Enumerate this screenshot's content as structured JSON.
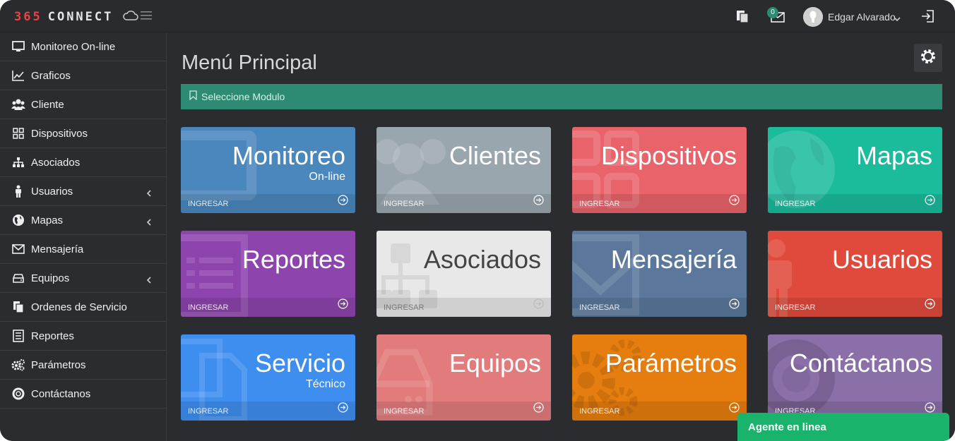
{
  "header": {
    "logo_number": "365",
    "logo_word": "CONNECT",
    "user_name": "Edgar Alvarado",
    "message_count": "0"
  },
  "sidebar": {
    "items": [
      {
        "label": "Monitoreo On-line",
        "icon": "monitor-icon"
      },
      {
        "label": "Graficos",
        "icon": "chart-icon"
      },
      {
        "label": "Cliente",
        "icon": "users-icon"
      },
      {
        "label": "Dispositivos",
        "icon": "grid-icon"
      },
      {
        "label": "Asociados",
        "icon": "sitemap-icon"
      },
      {
        "label": "Usuarios",
        "icon": "user-icon",
        "has_submenu": true
      },
      {
        "label": "Mapas",
        "icon": "globe-icon",
        "has_submenu": true
      },
      {
        "label": "Mensajería",
        "icon": "envelope-icon"
      },
      {
        "label": "Equipos",
        "icon": "device-icon",
        "has_submenu": true
      },
      {
        "label": "Ordenes de Servicio",
        "icon": "copy-icon"
      },
      {
        "label": "Reportes",
        "icon": "list-icon"
      },
      {
        "label": "Parámetros",
        "icon": "cogs-icon"
      },
      {
        "label": "Contáctanos",
        "icon": "lifering-icon"
      }
    ]
  },
  "main": {
    "title": "Menú Principal",
    "select_label": "Seleccione Modulo"
  },
  "tiles": [
    {
      "title": "Monitoreo",
      "subtitle": "On-line",
      "footer": "INGRESAR",
      "color": "#4a87bd"
    },
    {
      "title": "Clientes",
      "subtitle": "",
      "footer": "INGRESAR",
      "color": "#9aa6ad"
    },
    {
      "title": "Dispositivos",
      "subtitle": "",
      "footer": "INGRESAR",
      "color": "#e8636a"
    },
    {
      "title": "Mapas",
      "subtitle": "",
      "footer": "INGRESAR",
      "color": "#1abc9c"
    },
    {
      "title": "Reportes",
      "subtitle": "",
      "footer": "INGRESAR",
      "color": "#8e44ad"
    },
    {
      "title": "Asociados",
      "subtitle": "",
      "footer": "INGRESAR",
      "color": "#e8e8e8"
    },
    {
      "title": "Mensajería",
      "subtitle": "",
      "footer": "INGRESAR",
      "color": "#5b789c"
    },
    {
      "title": "Usuarios",
      "subtitle": "",
      "footer": "INGRESAR",
      "color": "#e04a3c"
    },
    {
      "title": "Servicio",
      "subtitle": "Técnico",
      "footer": "INGRESAR",
      "color": "#3e8ef0"
    },
    {
      "title": "Equipos",
      "subtitle": "",
      "footer": "INGRESAR",
      "color": "#e27b7c"
    },
    {
      "title": "Parámetros",
      "subtitle": "",
      "footer": "INGRESAR",
      "color": "#e67e0f"
    },
    {
      "title": "Contáctanos",
      "subtitle": "",
      "footer": "INGRESAR",
      "color": "#8a6fa8"
    }
  ],
  "chat": {
    "label": "Agente en linea",
    "color": "#19b36b"
  }
}
